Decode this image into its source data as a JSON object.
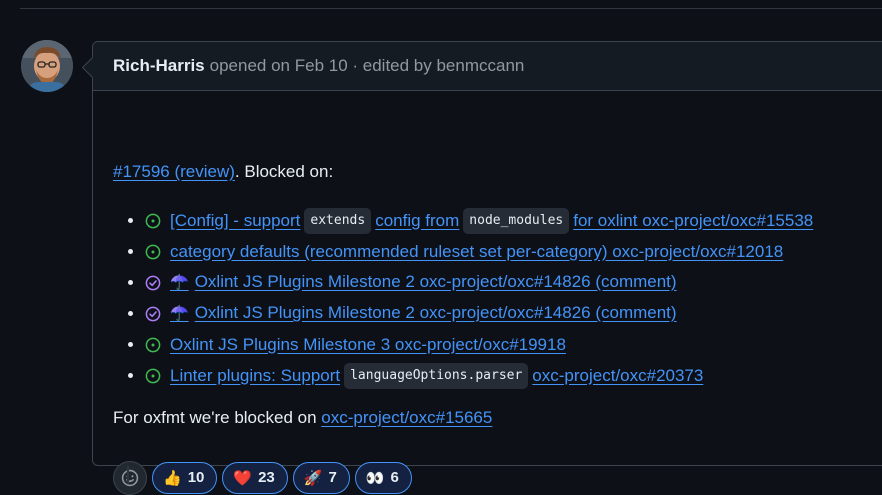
{
  "header": {
    "author": "Rich-Harris",
    "meta": "opened on Feb 10 · edited by benmccann"
  },
  "body": {
    "intro_link": "#17596 (review)",
    "intro_text": ". Blocked on:",
    "items": [
      {
        "status": "open",
        "text_before": "[Config] - support",
        "code1": "extends",
        "text_middle": "config from",
        "code2": "node_modules",
        "text_after": "for oxlint oxc-project/oxc#15538"
      },
      {
        "status": "open",
        "text": "category defaults (recommended ruleset set per-category) oxc-project/oxc#12018"
      },
      {
        "status": "completed",
        "emoji": "☂️",
        "text": "Oxlint JS Plugins Milestone 2 oxc-project/oxc#14826 (comment)"
      },
      {
        "status": "completed",
        "emoji": "☂️",
        "text": "Oxlint JS Plugins Milestone 2 oxc-project/oxc#14826 (comment)"
      },
      {
        "status": "open",
        "text": "Oxlint JS Plugins Milestone 3 oxc-project/oxc#19918"
      },
      {
        "status": "open",
        "text_before": "Linter plugins: Support",
        "code1": "languageOptions.parser",
        "text_after": "oxc-project/oxc#20373"
      }
    ],
    "outro_text": "For oxfmt we're blocked on",
    "outro_link": "oxc-project/oxc#15665"
  },
  "reactions": [
    {
      "emoji": "👍",
      "count": "10"
    },
    {
      "emoji": "❤️",
      "count": "23"
    },
    {
      "emoji": "🚀",
      "count": "7"
    },
    {
      "emoji": "👀",
      "count": "6"
    }
  ],
  "colors": {
    "open": "#3fb950",
    "completed": "#ab7df8",
    "link": "#4493f8"
  },
  "icons": {
    "add_reaction": "smiley-icon"
  }
}
